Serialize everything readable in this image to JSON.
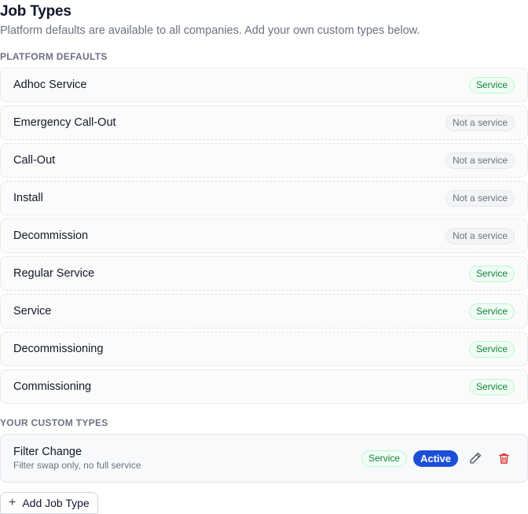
{
  "page": {
    "title": "Job Types",
    "subtitle": "Platform defaults are available to all companies. Add your own custom types below."
  },
  "defaults": {
    "label": "PLATFORM DEFAULTS",
    "items": [
      {
        "name": "Adhoc Service",
        "badge": "Service",
        "kind": "service"
      },
      {
        "name": "Emergency Call-Out",
        "badge": "Not a service",
        "kind": "not"
      },
      {
        "name": "Call-Out",
        "badge": "Not a service",
        "kind": "not"
      },
      {
        "name": "Install",
        "badge": "Not a service",
        "kind": "not"
      },
      {
        "name": "Decommission",
        "badge": "Not a service",
        "kind": "not"
      },
      {
        "name": "Regular Service",
        "badge": "Service",
        "kind": "service"
      },
      {
        "name": "Service",
        "badge": "Service",
        "kind": "service"
      },
      {
        "name": "Decommissioning",
        "badge": "Service",
        "kind": "service"
      },
      {
        "name": "Commissioning",
        "badge": "Service",
        "kind": "service"
      }
    ]
  },
  "custom": {
    "label": "YOUR CUSTOM TYPES",
    "items": [
      {
        "name": "Filter Change",
        "description": "Filter swap only, no full service",
        "badge": "Service",
        "status": "Active"
      }
    ]
  },
  "actions": {
    "add_label": "Add Job Type"
  },
  "icons": {
    "edit": "pencil-icon",
    "delete": "trash-icon",
    "add": "plus-icon"
  },
  "colors": {
    "service_text": "#15803d",
    "active_bg": "#1d4ed8",
    "delete": "#dc2626"
  }
}
